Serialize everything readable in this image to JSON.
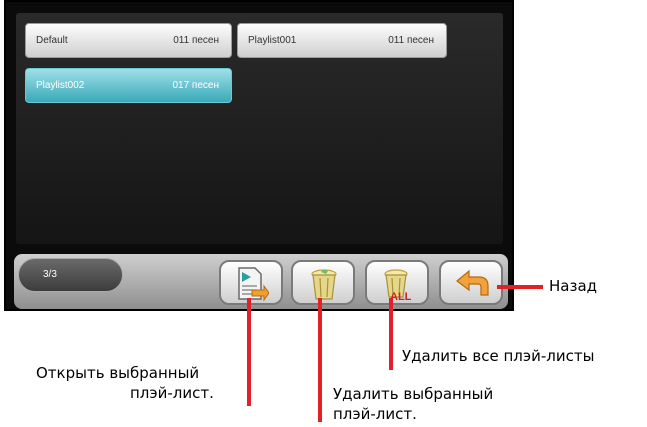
{
  "playlists": [
    {
      "name": "Default",
      "count": "011 песен",
      "selected": false
    },
    {
      "name": "Playlist001",
      "count": "011 песен",
      "selected": false
    },
    {
      "name": "Playlist002",
      "count": "017 песен",
      "selected": true
    }
  ],
  "toolbar": {
    "page_indicator": "3/3",
    "open_icon": "play-document-icon",
    "delete_icon": "trash-can-icon",
    "delete_all_icon": "trash-can-all-icon",
    "delete_all_badge": "ALL",
    "back_icon": "back-arrow-icon"
  },
  "callouts": {
    "back": "Назад",
    "delete_all": "Удалить все плэй-листы",
    "open_line1": "Открыть выбранный",
    "open_line2": "плэй-лист.",
    "delete_line1": "Удалить выбранный",
    "delete_line2": "плэй-лист."
  },
  "colors": {
    "leader": "#e3202a",
    "selected": "#3aa9b8"
  }
}
